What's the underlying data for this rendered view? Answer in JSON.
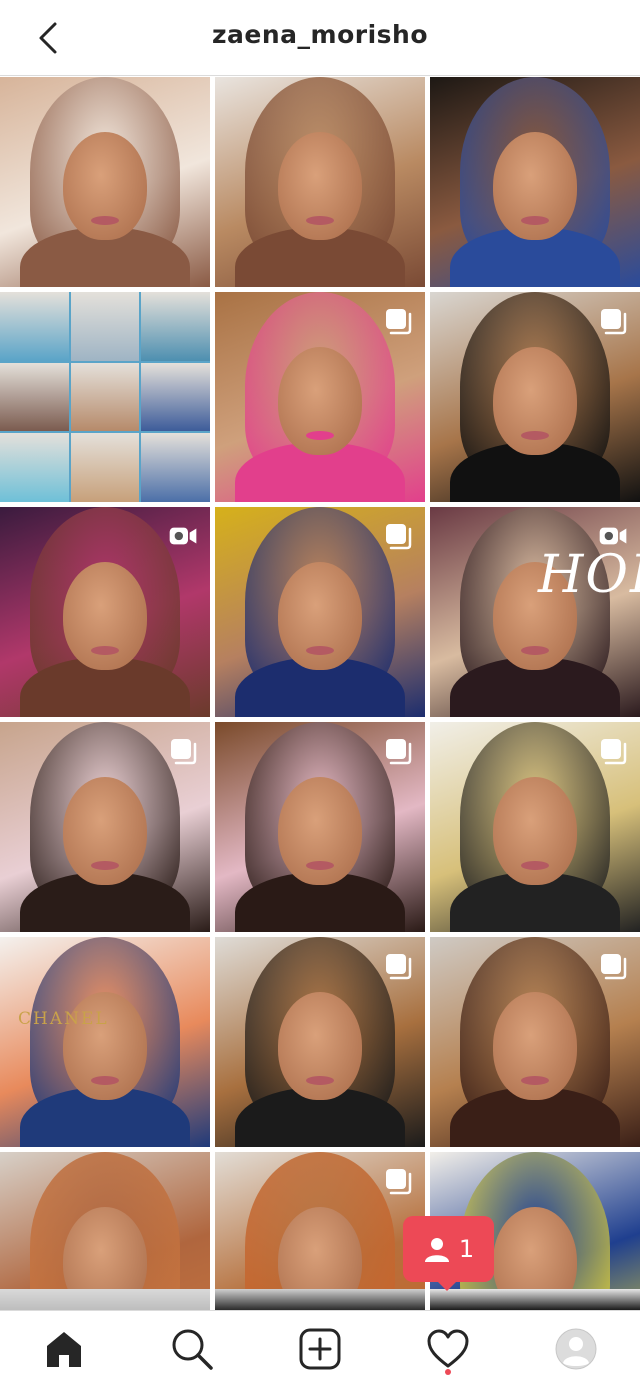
{
  "header": {
    "username": "zaena_morisho",
    "back_icon": "chevron-left-icon"
  },
  "grid": {
    "posts": [
      {
        "type": "photo",
        "scene": "restaurant-dinner",
        "palette": [
          "#d7b49a",
          "#f1e6dc",
          "#8a5a44"
        ]
      },
      {
        "type": "photo",
        "scene": "portrait-blonde",
        "palette": [
          "#e9e4df",
          "#b98a62",
          "#7a4a35"
        ]
      },
      {
        "type": "photo",
        "scene": "portrait-dark-hair",
        "palette": [
          "#1d1814",
          "#8a5a40",
          "#2a4b9b"
        ]
      },
      {
        "type": "photo",
        "scene": "event-collage",
        "palette": [
          "#5aa4c8",
          "#b7c9d6",
          "#7b5b4f"
        ]
      },
      {
        "type": "carousel",
        "scene": "portrait-curly-pink-lips",
        "palette": [
          "#a97244",
          "#cfa07c",
          "#e23f8c"
        ]
      },
      {
        "type": "carousel",
        "scene": "living-room-curly",
        "palette": [
          "#d9d6d1",
          "#a7754a",
          "#111111"
        ]
      },
      {
        "type": "video",
        "scene": "selfie-red-cap",
        "palette": [
          "#3a1b3e",
          "#b1386a",
          "#6a3a2b"
        ]
      },
      {
        "type": "carousel",
        "scene": "selfie-yellow-wall",
        "palette": [
          "#d6b11a",
          "#b68060",
          "#1c2d6e"
        ]
      },
      {
        "type": "video",
        "scene": "hol-title-card",
        "palette": [
          "#6a3a44",
          "#d8bba0",
          "#2b1a1e"
        ]
      },
      {
        "type": "carousel",
        "scene": "pink-outfit-seated",
        "palette": [
          "#c7a48c",
          "#e9cfd4",
          "#2a1c18"
        ]
      },
      {
        "type": "carousel",
        "scene": "pink-dress-ornate",
        "palette": [
          "#7a4a2a",
          "#e3b8c4",
          "#2a1a16"
        ]
      },
      {
        "type": "carousel",
        "scene": "white-dress-showroom",
        "palette": [
          "#f1efe8",
          "#d7c07a",
          "#222222"
        ]
      },
      {
        "type": "photo",
        "scene": "chanel-bag-drink",
        "palette": [
          "#f4f1ee",
          "#e88a5c",
          "#1f3a7a"
        ]
      },
      {
        "type": "carousel",
        "scene": "kitchen-black-top",
        "palette": [
          "#dfdcd7",
          "#a8703f",
          "#1b1b1b"
        ]
      },
      {
        "type": "carousel",
        "scene": "kitchen-closeup",
        "palette": [
          "#cfcac4",
          "#b5804f",
          "#3a1f17"
        ]
      },
      {
        "type": "photo",
        "scene": "bangs-closeup",
        "palette": [
          "#d7d0c8",
          "#b0663e",
          "#c8753f"
        ]
      },
      {
        "type": "carousel",
        "scene": "orange-sweater",
        "palette": [
          "#e2ddd6",
          "#b6703c",
          "#c8642c"
        ]
      },
      {
        "type": "photo",
        "scene": "blue-yellow-outfit",
        "palette": [
          "#f2efe9",
          "#1f3f8f",
          "#e0d23a"
        ]
      }
    ],
    "partial_row": [
      {
        "palette": [
          "#d9d9d9",
          "#bdbdbd"
        ]
      },
      {
        "palette": [
          "#cfcfcf",
          "#2b2b2b"
        ]
      },
      {
        "palette": [
          "#e6e6e6",
          "#1b1b1b"
        ]
      }
    ]
  },
  "notification": {
    "count": "1",
    "icon": "person-icon",
    "color": "#ed4956"
  },
  "tab_bar": {
    "items": [
      {
        "name": "home",
        "icon": "home-icon",
        "active": true
      },
      {
        "name": "search",
        "icon": "search-icon",
        "active": false
      },
      {
        "name": "new-post",
        "icon": "plus-square-icon",
        "active": false
      },
      {
        "name": "activity",
        "icon": "heart-icon",
        "active": false,
        "has_dot": true
      },
      {
        "name": "profile",
        "icon": "avatar-icon",
        "active": false
      }
    ]
  },
  "tile_text": {
    "chanel": "CHANEL",
    "hol": "HOL"
  }
}
